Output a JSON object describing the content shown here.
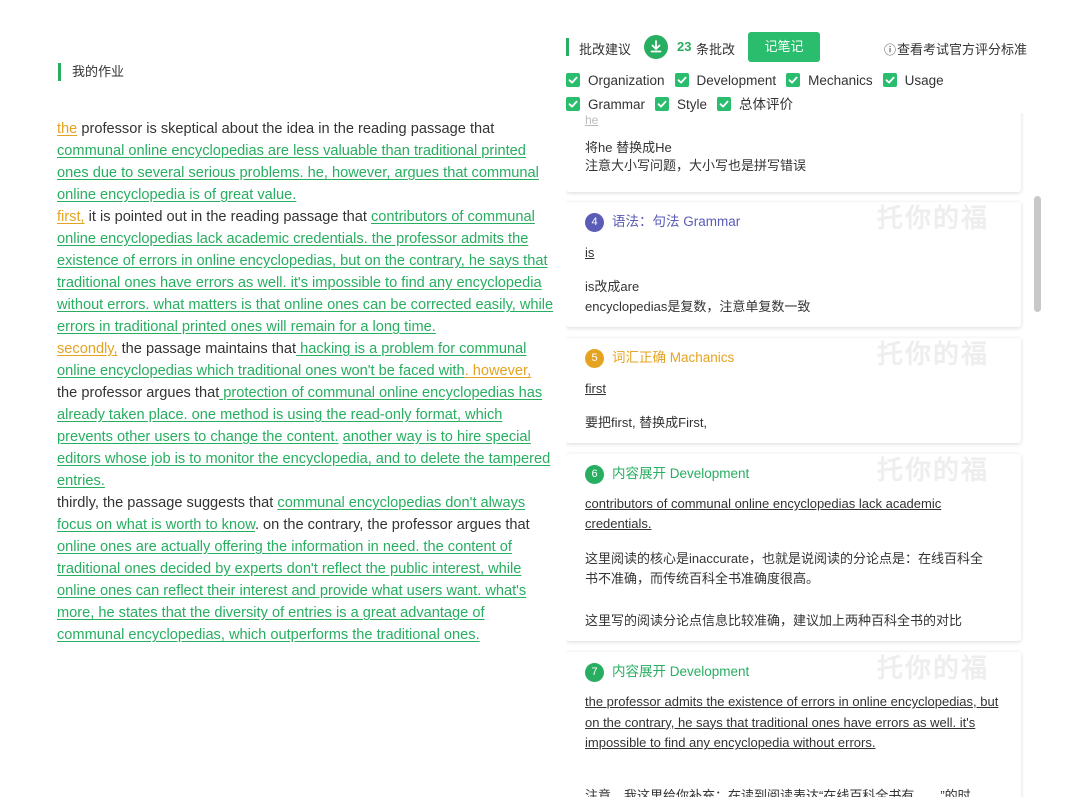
{
  "left": {
    "title": "我的作业",
    "essay": [
      {
        "t": "the",
        "s": "yellow-u"
      },
      {
        "t": " professor is skeptical about the idea in the reading passage that ",
        "s": "plain"
      },
      {
        "t": "communal online encyclopedias are less valuable than traditional printed ones due to several serious problems. he, however, argues that communal online encyclopedia is of great value.",
        "s": "green"
      },
      {
        "t": "\n",
        "s": "br"
      },
      {
        "t": "first,",
        "s": "yellow-u"
      },
      {
        "t": " it is pointed out in the reading passage that ",
        "s": "plain"
      },
      {
        "t": "contributors of communal online encyclopedias lack academic credentials. the professor admits the existence of errors in online encyclopedias, but on the contrary, he says that traditional ones have errors as well. it's impossible to find any encyclopedia without errors. what matters is that online ones can be corrected easily, while errors in traditional printed ones will remain for a long time.",
        "s": "green"
      },
      {
        "t": "\n",
        "s": "br"
      },
      {
        "t": "secondly,",
        "s": "yellow-u"
      },
      {
        "t": " the passage maintains that",
        "s": "plain"
      },
      {
        "t": " hacking is a problem for communal online encyclopedias which traditional ones won't be faced with",
        "s": "green"
      },
      {
        "t": ". however,",
        "s": "yellow-u"
      },
      {
        "t": " the professor argues that",
        "s": "plain"
      },
      {
        "t": " protection of communal online encyclopedias has already taken place. one method is using the read-only format, which prevents other users to change the content.",
        "s": "green"
      },
      {
        "t": " ",
        "s": "plain"
      },
      {
        "t": "another way is to hire special editors whose job is to monitor the encyclopedia, and to delete the tampered entries.",
        "s": "green"
      },
      {
        "t": "\n",
        "s": "br"
      },
      {
        "t": "thirdly, the passage suggests that ",
        "s": "plain"
      },
      {
        "t": "communal encyclopedias don't always focus on what is worth to know",
        "s": "green"
      },
      {
        "t": ". on the contrary, the professor argues that ",
        "s": "plain"
      },
      {
        "t": "online ones are actually offering the information in need. the content of traditional ones decided by experts don't reflect the public interest, while online ones can reflect their interest and provide what users want. what's more, he states that the diversity of entries is a great advantage of communal encyclopedias, which outperforms the traditional ones.",
        "s": "green"
      }
    ]
  },
  "header": {
    "title": "批改建议",
    "count": "23",
    "count_label": "条批改",
    "note_button": "记笔记",
    "official_info": "ⓘ",
    "official": "查看考试官方评分标准"
  },
  "filters": {
    "row1": [
      "Organization",
      "Development",
      "Mechanics",
      "Usage"
    ],
    "row2": [
      "Grammar",
      "Style",
      "总体评价"
    ]
  },
  "cards": [
    {
      "partial_quote": "he",
      "lines": [
        "将he 替换成He",
        "注意大小写问题，大小写也是拼写错误"
      ]
    },
    {
      "num": "4",
      "color": "#5b5bb8",
      "title": "语法：句法 Grammar",
      "quote": "is",
      "lines": [
        "is改成are",
        "encyclopedias是复数，注意单复数一致"
      ]
    },
    {
      "num": "5",
      "color": "#e5a321",
      "title": "词汇正确 Machanics",
      "quote": "first",
      "lines": [
        "要把first, 替换成First,"
      ]
    },
    {
      "num": "6",
      "color": "#27ae60",
      "title": "内容展开 Development",
      "quote": "contributors of communal online encyclopedias lack academic credentials.",
      "p1": "这里阅读的核心是inaccurate，也就是说阅读的分论点是：在线百科全书不准确，而传统百科全书准确度很高。",
      "p2": "这里写的阅读分论点信息比较准确，建议加上两种百科全书的对比"
    },
    {
      "num": "7",
      "color": "#27ae60",
      "title": "内容展开 Development",
      "quote": "the professor admits the existence of errors in online encyclopedias, but on the contrary, he says that traditional ones have errors as well. it's impossible to find any encyclopedia without errors.",
      "p1": "注意，我这里给你补充：在读到阅读表达“在线百科全书有……”的时"
    }
  ],
  "watermark": "托你的福",
  "colors": {
    "accent": "#27ae60",
    "button": "#2bbd6e",
    "yellow": "#e5a321",
    "purple": "#5b5bb8"
  }
}
